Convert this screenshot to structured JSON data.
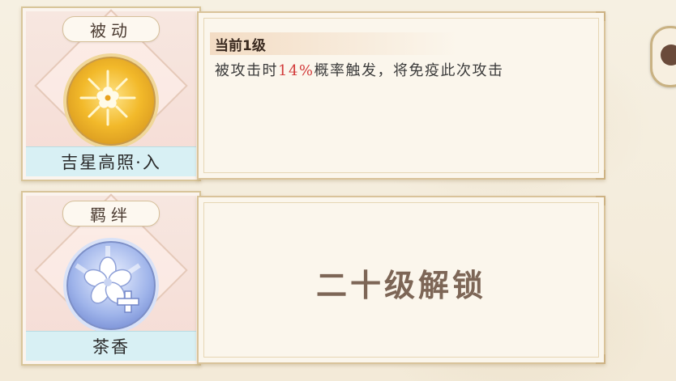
{
  "skills": [
    {
      "type_label": "被动",
      "name": "吉星高照·入",
      "icon": "golden-flower-emblem-icon",
      "level_label": "当前1级",
      "description_pre": "被攻击时",
      "description_highlight": "14%",
      "description_post": "概率触发，将免疫此次攻击",
      "colors": {
        "highlight": "#d23a3a",
        "orb": "#f2b92a"
      }
    },
    {
      "type_label": "羁绊",
      "name": "茶香",
      "icon": "sakura-plus-emblem-icon",
      "locked_text": "二十级解锁",
      "colors": {
        "orb": "#9fb4ea"
      }
    }
  ]
}
